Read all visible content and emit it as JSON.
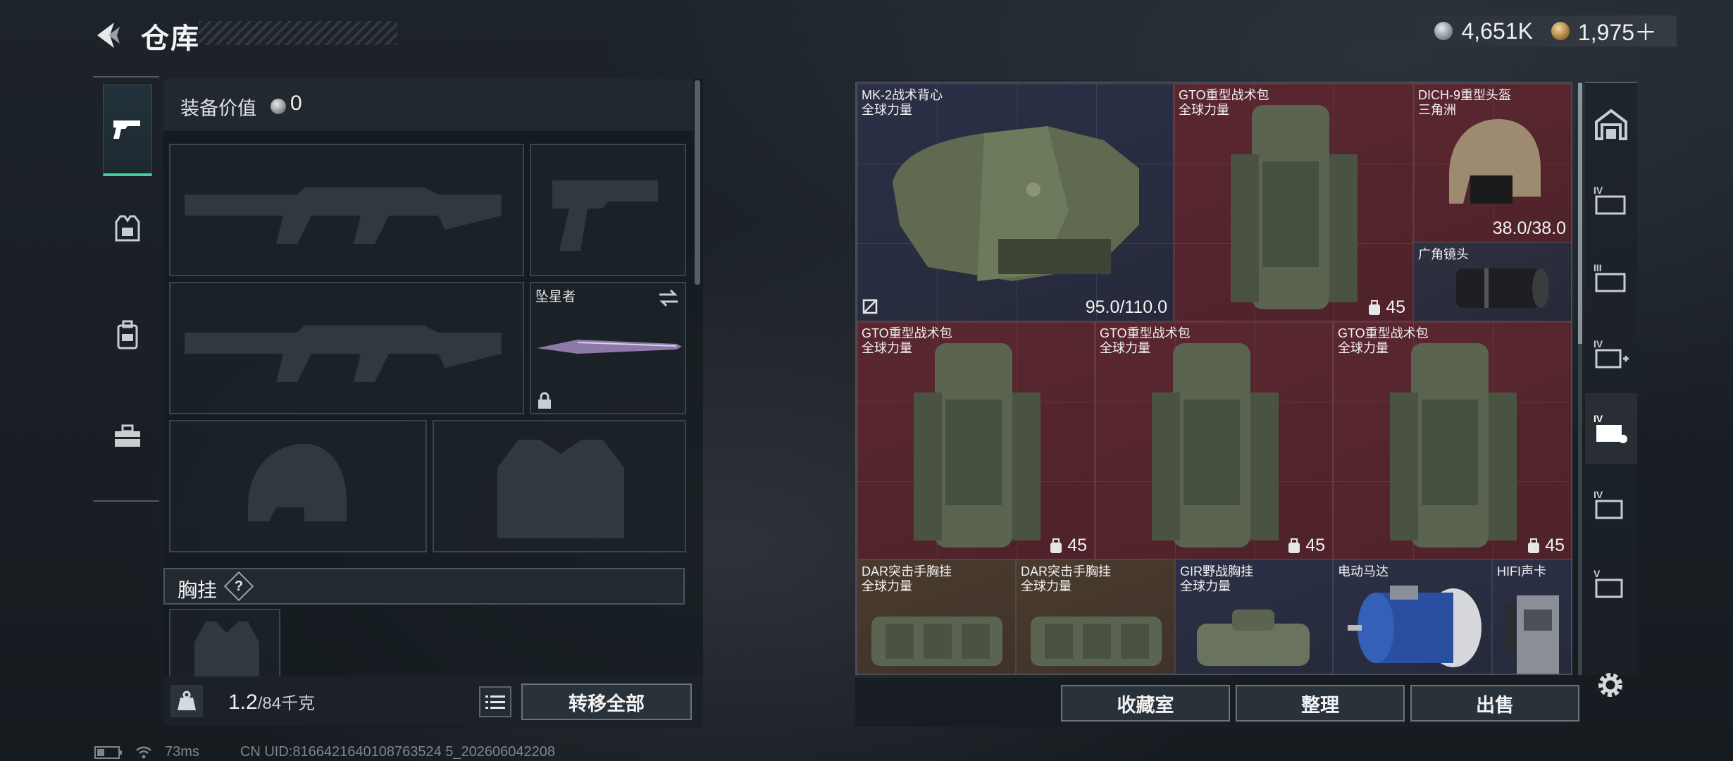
{
  "header": {
    "title": "仓库"
  },
  "currency": {
    "silver": "4,651K",
    "gold": "1,975＋"
  },
  "left_nav": {
    "items": [
      "weapon",
      "armor",
      "backpack",
      "toolbox"
    ]
  },
  "equipment": {
    "value_label": "装备价值",
    "value": "0",
    "melee_slot": {
      "name": "坠星者"
    },
    "chest_label": "胸挂",
    "chest_help": "?",
    "weight_value": "1.2",
    "weight_max": "/84千克",
    "transfer_all": "转移全部"
  },
  "warehouse": {
    "items": [
      {
        "name": "MK-2战术背心",
        "sub": "全球力量",
        "value": "95.0/110.0",
        "color": "blue"
      },
      {
        "name": "GTO重型战术包",
        "sub": "全球力量",
        "capacity": "45",
        "color": "red"
      },
      {
        "name": "DICH-9重型头盔",
        "sub": "三角洲",
        "value": "38.0/38.0",
        "color": "red"
      },
      {
        "name": "广角镜头",
        "sub": "",
        "color": "grey"
      },
      {
        "name": "GTO重型战术包",
        "sub": "全球力量",
        "capacity": "45",
        "color": "red"
      },
      {
        "name": "GTO重型战术包",
        "sub": "全球力量",
        "capacity": "45",
        "color": "red"
      },
      {
        "name": "GTO重型战术包",
        "sub": "全球力量",
        "capacity": "45",
        "color": "red"
      },
      {
        "name": "DAR突击手胸挂",
        "sub": "全球力量",
        "color": "tan"
      },
      {
        "name": "DAR突击手胸挂",
        "sub": "全球力量",
        "color": "tan"
      },
      {
        "name": "GIR野战胸挂",
        "sub": "全球力量",
        "color": "blue"
      },
      {
        "name": "电动马达",
        "sub": "",
        "color": "blue"
      },
      {
        "name": "HIFI声卡",
        "sub": "",
        "color": "blue"
      }
    ],
    "buttons": {
      "collection": "收藏室",
      "organize": "整理",
      "sell": "出售"
    }
  },
  "right_nav": {
    "items": [
      "home",
      "IV",
      "III",
      "IV",
      "IV",
      "IV",
      "V"
    ]
  },
  "status": {
    "ping": "73ms",
    "uid": "CN UID:8166421640108763524 5_202606042208"
  }
}
